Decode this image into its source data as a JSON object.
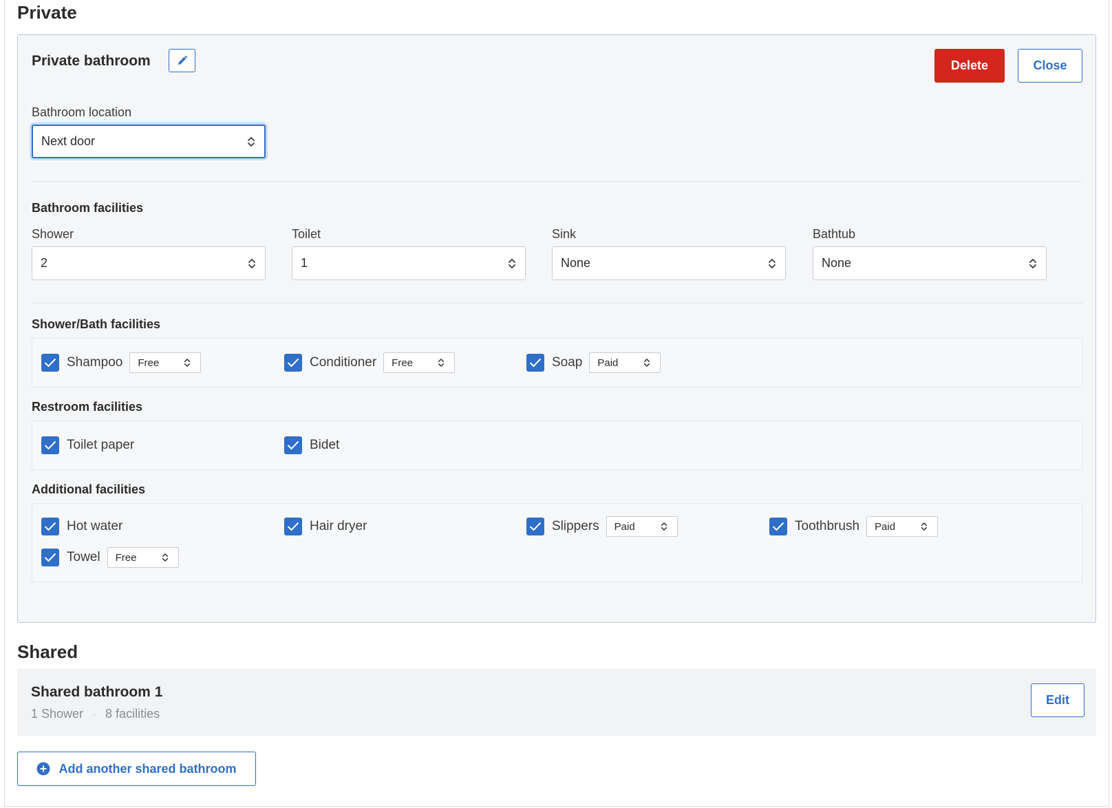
{
  "sections": {
    "private_title": "Private",
    "shared_title": "Shared"
  },
  "private_bathroom": {
    "title": "Private bathroom",
    "delete_label": "Delete",
    "close_label": "Close",
    "location": {
      "label": "Bathroom location",
      "value": "Next door"
    },
    "facilities": {
      "title": "Bathroom facilities",
      "shower": {
        "label": "Shower",
        "value": "2"
      },
      "toilet": {
        "label": "Toilet",
        "value": "1"
      },
      "sink": {
        "label": "Sink",
        "value": "None"
      },
      "bathtub": {
        "label": "Bathtub",
        "value": "None"
      }
    },
    "shower_bath": {
      "title": "Shower/Bath facilities",
      "items": [
        {
          "label": "Shampoo",
          "checked": true,
          "price": "Free"
        },
        {
          "label": "Conditioner",
          "checked": true,
          "price": "Free"
        },
        {
          "label": "Soap",
          "checked": true,
          "price": "Paid"
        }
      ]
    },
    "restroom": {
      "title": "Restroom facilities",
      "items": [
        {
          "label": "Toilet paper",
          "checked": true
        },
        {
          "label": "Bidet",
          "checked": true
        }
      ]
    },
    "additional": {
      "title": "Additional facilities",
      "items": [
        {
          "label": "Hot water",
          "checked": true
        },
        {
          "label": "Hair dryer",
          "checked": true
        },
        {
          "label": "Slippers",
          "checked": true,
          "price": "Paid"
        },
        {
          "label": "Toothbrush",
          "checked": true,
          "price": "Paid"
        },
        {
          "label": "Towel",
          "checked": true,
          "price": "Free"
        }
      ]
    }
  },
  "shared_bathrooms": [
    {
      "title": "Shared bathroom 1",
      "meta_shower": "1 Shower",
      "meta_separator": "·",
      "meta_facilities": "8 facilities",
      "edit_label": "Edit"
    }
  ],
  "add_shared_label": "Add another shared bathroom",
  "colors": {
    "accent": "#2f6fc9",
    "danger": "#d3261c"
  }
}
